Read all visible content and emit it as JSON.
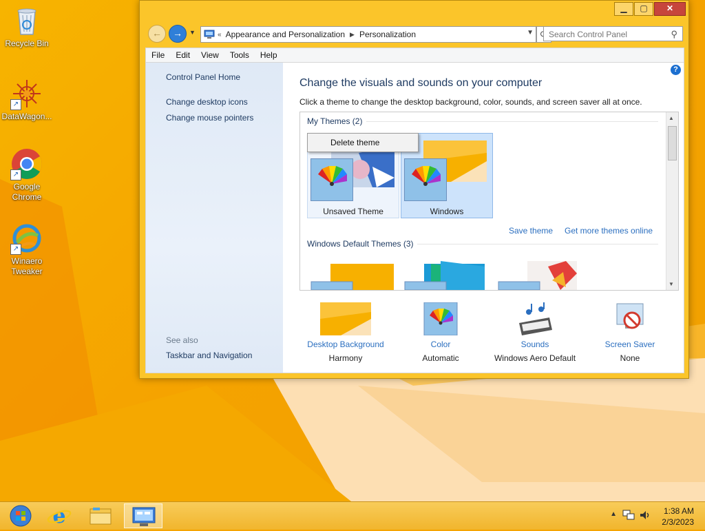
{
  "desktop": {
    "icons": [
      {
        "label": "Recycle Bin"
      },
      {
        "label": "DataWagon..."
      },
      {
        "label": "Google\nChrome"
      },
      {
        "label": "Winaero\nTweaker"
      }
    ]
  },
  "window": {
    "breadcrumb": {
      "items": [
        "Appearance and Personalization",
        "Personalization"
      ],
      "overflow": "«"
    },
    "search": {
      "placeholder": "Search Control Panel"
    },
    "menu": [
      "File",
      "Edit",
      "View",
      "Tools",
      "Help"
    ],
    "left_pane": {
      "links": [
        "Control Panel Home",
        "Change desktop icons",
        "Change mouse pointers"
      ],
      "see_also_label": "See also",
      "see_also_links": [
        "Taskbar and Navigation"
      ]
    },
    "main": {
      "heading": "Change the visuals and sounds on your computer",
      "subheading": "Click a theme to change the desktop background, color, sounds, and screen saver all at once.",
      "my_themes": {
        "title": "My Themes (2)",
        "themes": [
          {
            "name": "Unsaved Theme",
            "state": "hover"
          },
          {
            "name": "Windows",
            "state": "selected"
          }
        ]
      },
      "context_menu": {
        "items": [
          "Delete theme"
        ]
      },
      "links": {
        "save_theme": "Save theme",
        "more_themes": "Get more themes online"
      },
      "default_themes": {
        "title": "Windows Default Themes (3)"
      },
      "settings": [
        {
          "label": "Desktop Background",
          "value": "Harmony"
        },
        {
          "label": "Color",
          "value": "Automatic"
        },
        {
          "label": "Sounds",
          "value": "Windows Aero Default"
        },
        {
          "label": "Screen Saver",
          "value": "None"
        }
      ]
    }
  },
  "taskbar": {
    "clock": {
      "time": "1:38 AM",
      "date": "2/3/2023"
    }
  },
  "colors": {
    "window_frame": "#fbc52a",
    "link_blue": "#2a6ebf",
    "heading_blue": "#1e3a61",
    "selected_tile": "#cde3fb"
  }
}
